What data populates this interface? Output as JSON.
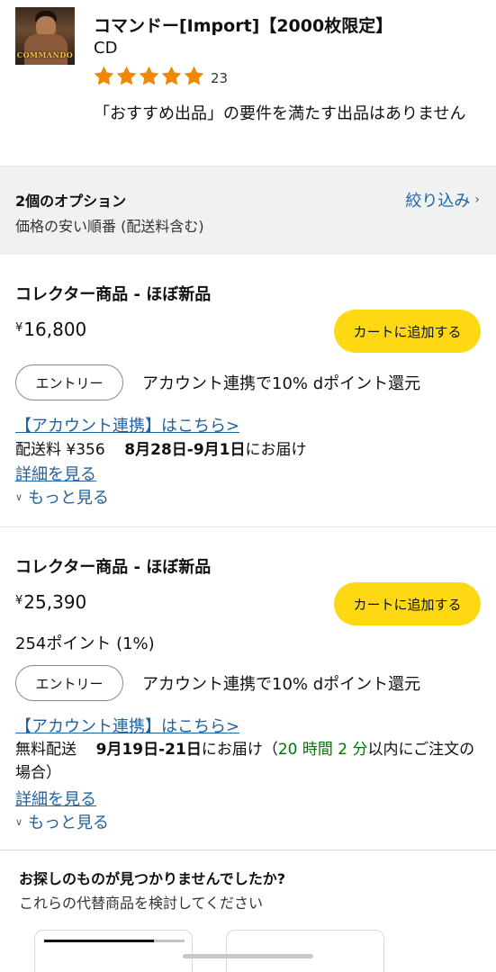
{
  "product": {
    "title": "コマンドー[Import]【2000枚限定】",
    "format": "CD",
    "rating": 5,
    "rating_count": "23",
    "thumbnail_text": "COMMANDO",
    "notice": "「おすすめ出品」の要件を満たす出品はありません"
  },
  "options": {
    "count_label": "2個のオプション",
    "sort_label": "価格の安い順番 (配送料含む)",
    "filter_label": "絞り込み",
    "filter_icon": "chevron-right-icon"
  },
  "offers": [
    {
      "condition": "コレクター商品 - ほぼ新品",
      "currency": "¥",
      "price": "16,800",
      "cart_button": "カートに追加する",
      "entry_button": "エントリー",
      "entry_text": "アカウント連携で10% dポイント還元",
      "account_link": "【アカウント連携】はこちら>",
      "shipping_fee": "配送料 ¥356",
      "delivery_date": "8月28日-9月1日",
      "delivery_suffix": "にお届け",
      "details_link": "詳細を見る",
      "more_label": "もっと見る"
    },
    {
      "condition": "コレクター商品 - ほぼ新品",
      "currency": "¥",
      "price": "25,390",
      "points": "254ポイント (1%)",
      "cart_button": "カートに追加する",
      "entry_button": "エントリー",
      "entry_text": "アカウント連携で10% dポイント還元",
      "account_link": "【アカウント連携】はこちら>",
      "shipping_fee": "無料配送",
      "delivery_date": "9月19日-21日",
      "delivery_suffix": "にお届け（",
      "countdown": "20 時間 2 分",
      "countdown_suffix": "以内にご注文の場合）",
      "details_link": "詳細を見る",
      "more_label": "もっと見る"
    }
  ],
  "suggestion": {
    "title": "お探しのものが見つかりませんでしたか?",
    "subtitle": "これらの代替商品を検討してください",
    "carousel_progress": 0.78
  },
  "colors": {
    "accent_button": "#ffd814",
    "star": "#f08804",
    "link": "#2162a1",
    "countdown": "#007600"
  }
}
